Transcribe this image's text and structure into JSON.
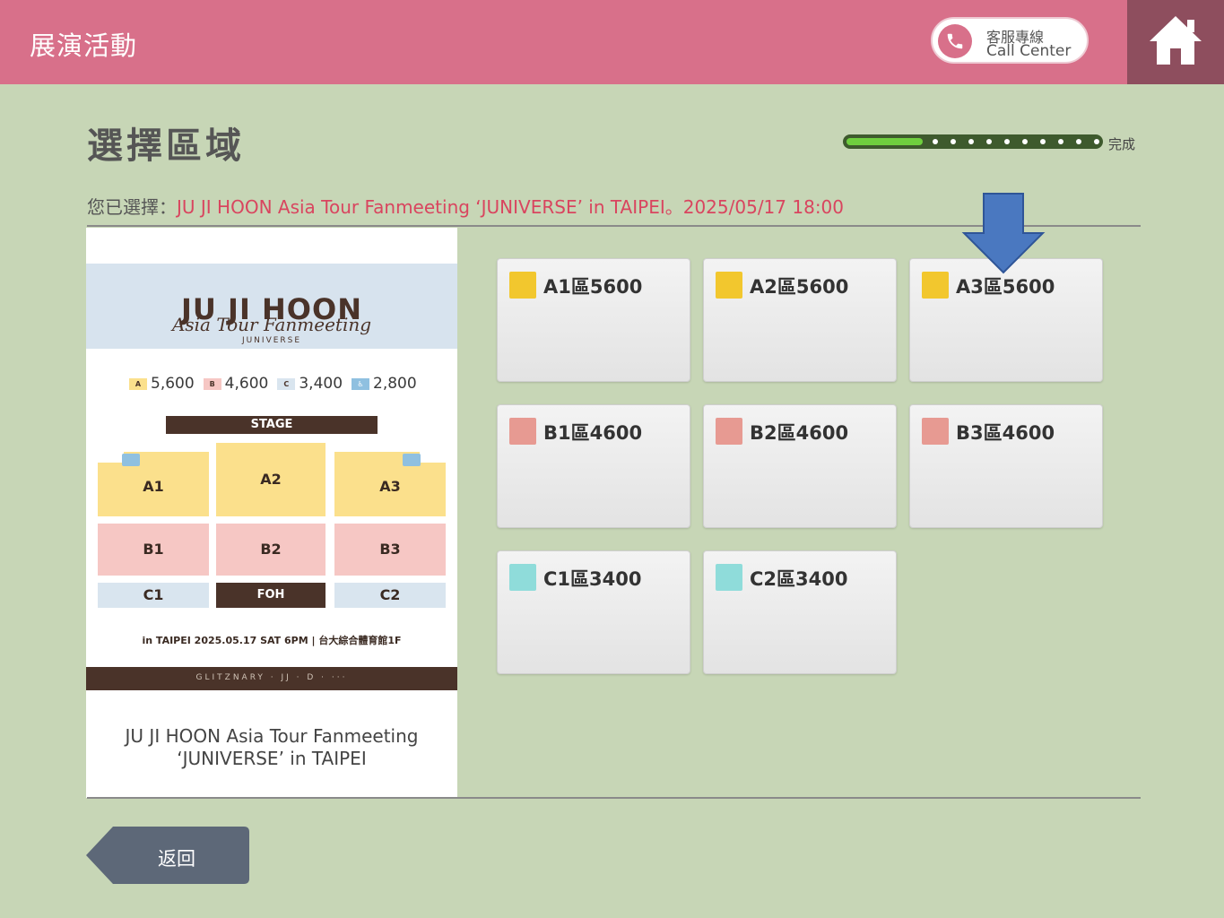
{
  "header": {
    "title": "展演活動",
    "call_center_zh": "客服專線",
    "call_center_en": "Call Center",
    "colors": {
      "header_bg": "#d8708a",
      "home_bg": "#8e4e5e"
    }
  },
  "page": {
    "title": "選擇區域",
    "progress_label": "完成",
    "progress_fraction": 0.3
  },
  "selection": {
    "label": "您已選擇：",
    "value": "JU JI HOON Asia Tour Fanmeeting ‘JUNIVERSE’ in TAIPEI。2025/05/17 18:00"
  },
  "poster": {
    "logo": "JU JI HOON",
    "script": "Asia Tour Fanmeeting",
    "subtitle": "JUNIVERSE",
    "prices": [
      {
        "tag": "A",
        "price": "5,600"
      },
      {
        "tag": "B",
        "price": "4,600"
      },
      {
        "tag": "C",
        "price": "3,400"
      },
      {
        "tag": "♿",
        "price": "2,800"
      }
    ],
    "stage": "STAGE",
    "zones": {
      "a1": "A1",
      "a2": "A2",
      "a3": "A3",
      "b1": "B1",
      "b2": "B2",
      "b3": "B3",
      "c1": "C1",
      "foh": "FOH",
      "c2": "C2"
    },
    "date_line": "in TAIPEI  2025.05.17 SAT 6PM | 台大綜合體育館1F",
    "footer_sponsors": "GLITZNARY · JJ · D · ···",
    "caption_line1": "JU JI HOON Asia Tour Fanmeeting",
    "caption_line2": "‘JUNIVERSE’ in TAIPEI"
  },
  "tiles": [
    {
      "label": "A1區5600",
      "color": "#f2c72e"
    },
    {
      "label": "A2區5600",
      "color": "#f2c72e"
    },
    {
      "label": "A3區5600",
      "color": "#f2c72e"
    },
    {
      "label": "B1區4600",
      "color": "#e79a92"
    },
    {
      "label": "B2區4600",
      "color": "#e79a92"
    },
    {
      "label": "B3區4600",
      "color": "#e79a92"
    },
    {
      "label": "C1區3400",
      "color": "#8fdcda"
    },
    {
      "label": "C2區3400",
      "color": "#8fdcda"
    }
  ],
  "back_button": {
    "label": "返回"
  },
  "annotation": {
    "arrow_color": "#4a78c0",
    "points_to": "A3區5600"
  }
}
